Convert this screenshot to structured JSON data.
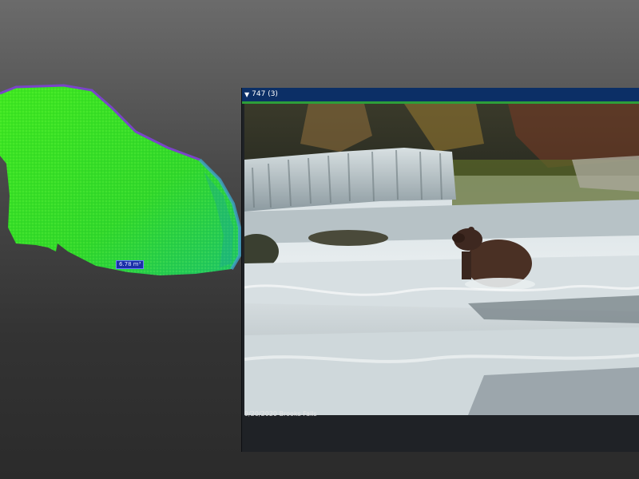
{
  "scan": {
    "volume_label": "6.78 m³",
    "colors": {
      "primary": "#36e11f",
      "secondary": "#1ec46a",
      "edge": "#7a45c8",
      "rim": "#3fa3c8"
    }
  },
  "photo_panel": {
    "header_icon": "triangle-down-icon",
    "title": "747 (3)",
    "caption": "9/20/2020 Brooks Falls",
    "colors": {
      "header": "#0c2f66",
      "accent": "#2e9e3a"
    }
  }
}
